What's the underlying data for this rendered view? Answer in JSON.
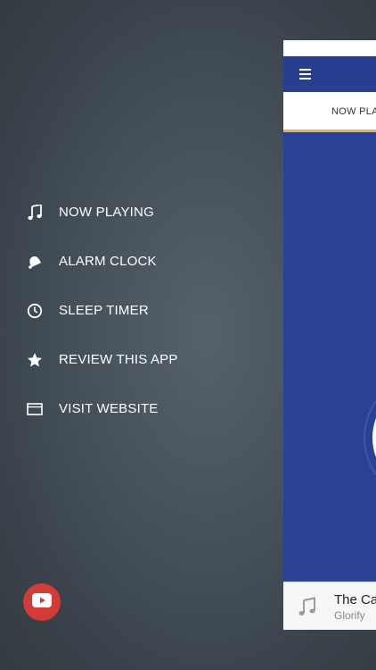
{
  "menu": {
    "items": [
      {
        "label": "NOW PLAYING",
        "icon": "music-note-icon"
      },
      {
        "label": "ALARM CLOCK",
        "icon": "alarm-bell-icon"
      },
      {
        "label": "SLEEP TIMER",
        "icon": "clock-icon"
      },
      {
        "label": "REVIEW THIS APP",
        "icon": "star-icon"
      },
      {
        "label": "VISIT WEBSITE",
        "icon": "browser-window-icon"
      }
    ]
  },
  "social": {
    "icon": "youtube-icon",
    "color": "#d43a36"
  },
  "panel": {
    "tab_label": "NOW PLA",
    "header_color": "#283f8f",
    "accent_color": "#e8b449",
    "mini_player": {
      "title": "The Ca",
      "artist": "Glorify"
    }
  }
}
